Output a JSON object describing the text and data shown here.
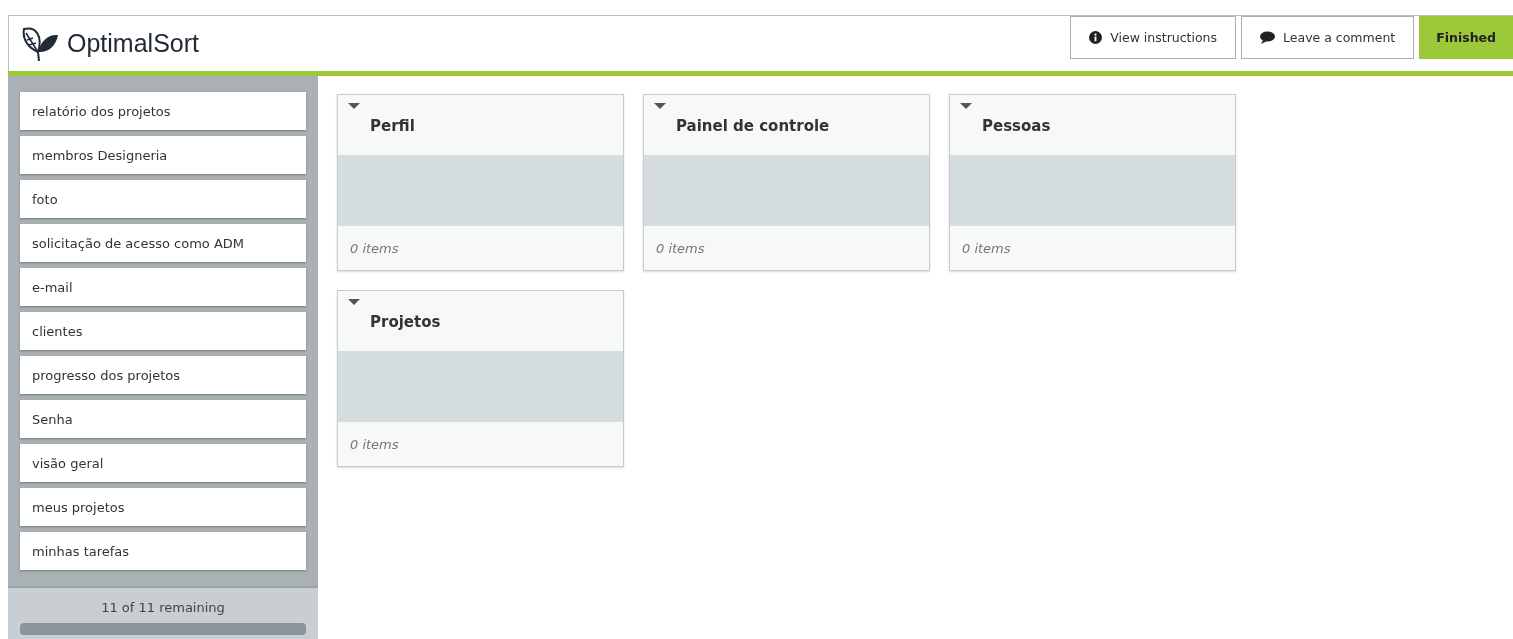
{
  "header": {
    "logo": "OptimalSort",
    "buttons": [
      {
        "label": "View instructions",
        "kind": "info"
      },
      {
        "label": "Leave a comment",
        "kind": "comment"
      },
      {
        "label": "Finished",
        "kind": "primary"
      }
    ]
  },
  "cards": [
    {
      "label": "relatório dos projetos"
    },
    {
      "label": "membros Designeria"
    },
    {
      "label": "foto"
    },
    {
      "label": "solicitação de acesso como ADM"
    },
    {
      "label": "e-mail"
    },
    {
      "label": "clientes"
    },
    {
      "label": "progresso dos projetos"
    },
    {
      "label": "Senha"
    },
    {
      "label": "visão geral"
    },
    {
      "label": "meus projetos"
    },
    {
      "label": "minhas tarefas"
    }
  ],
  "remaining": "11 of 11 remaining",
  "groups": [
    {
      "title": "Perfil",
      "count": "0 items",
      "expanded": true
    },
    {
      "title": "Painel de controle",
      "count": "0 items",
      "expanded": true
    },
    {
      "title": "Pessoas",
      "count": "0 items",
      "expanded": true
    },
    {
      "title": "Projetos",
      "count": "0 items",
      "expanded": true
    }
  ]
}
